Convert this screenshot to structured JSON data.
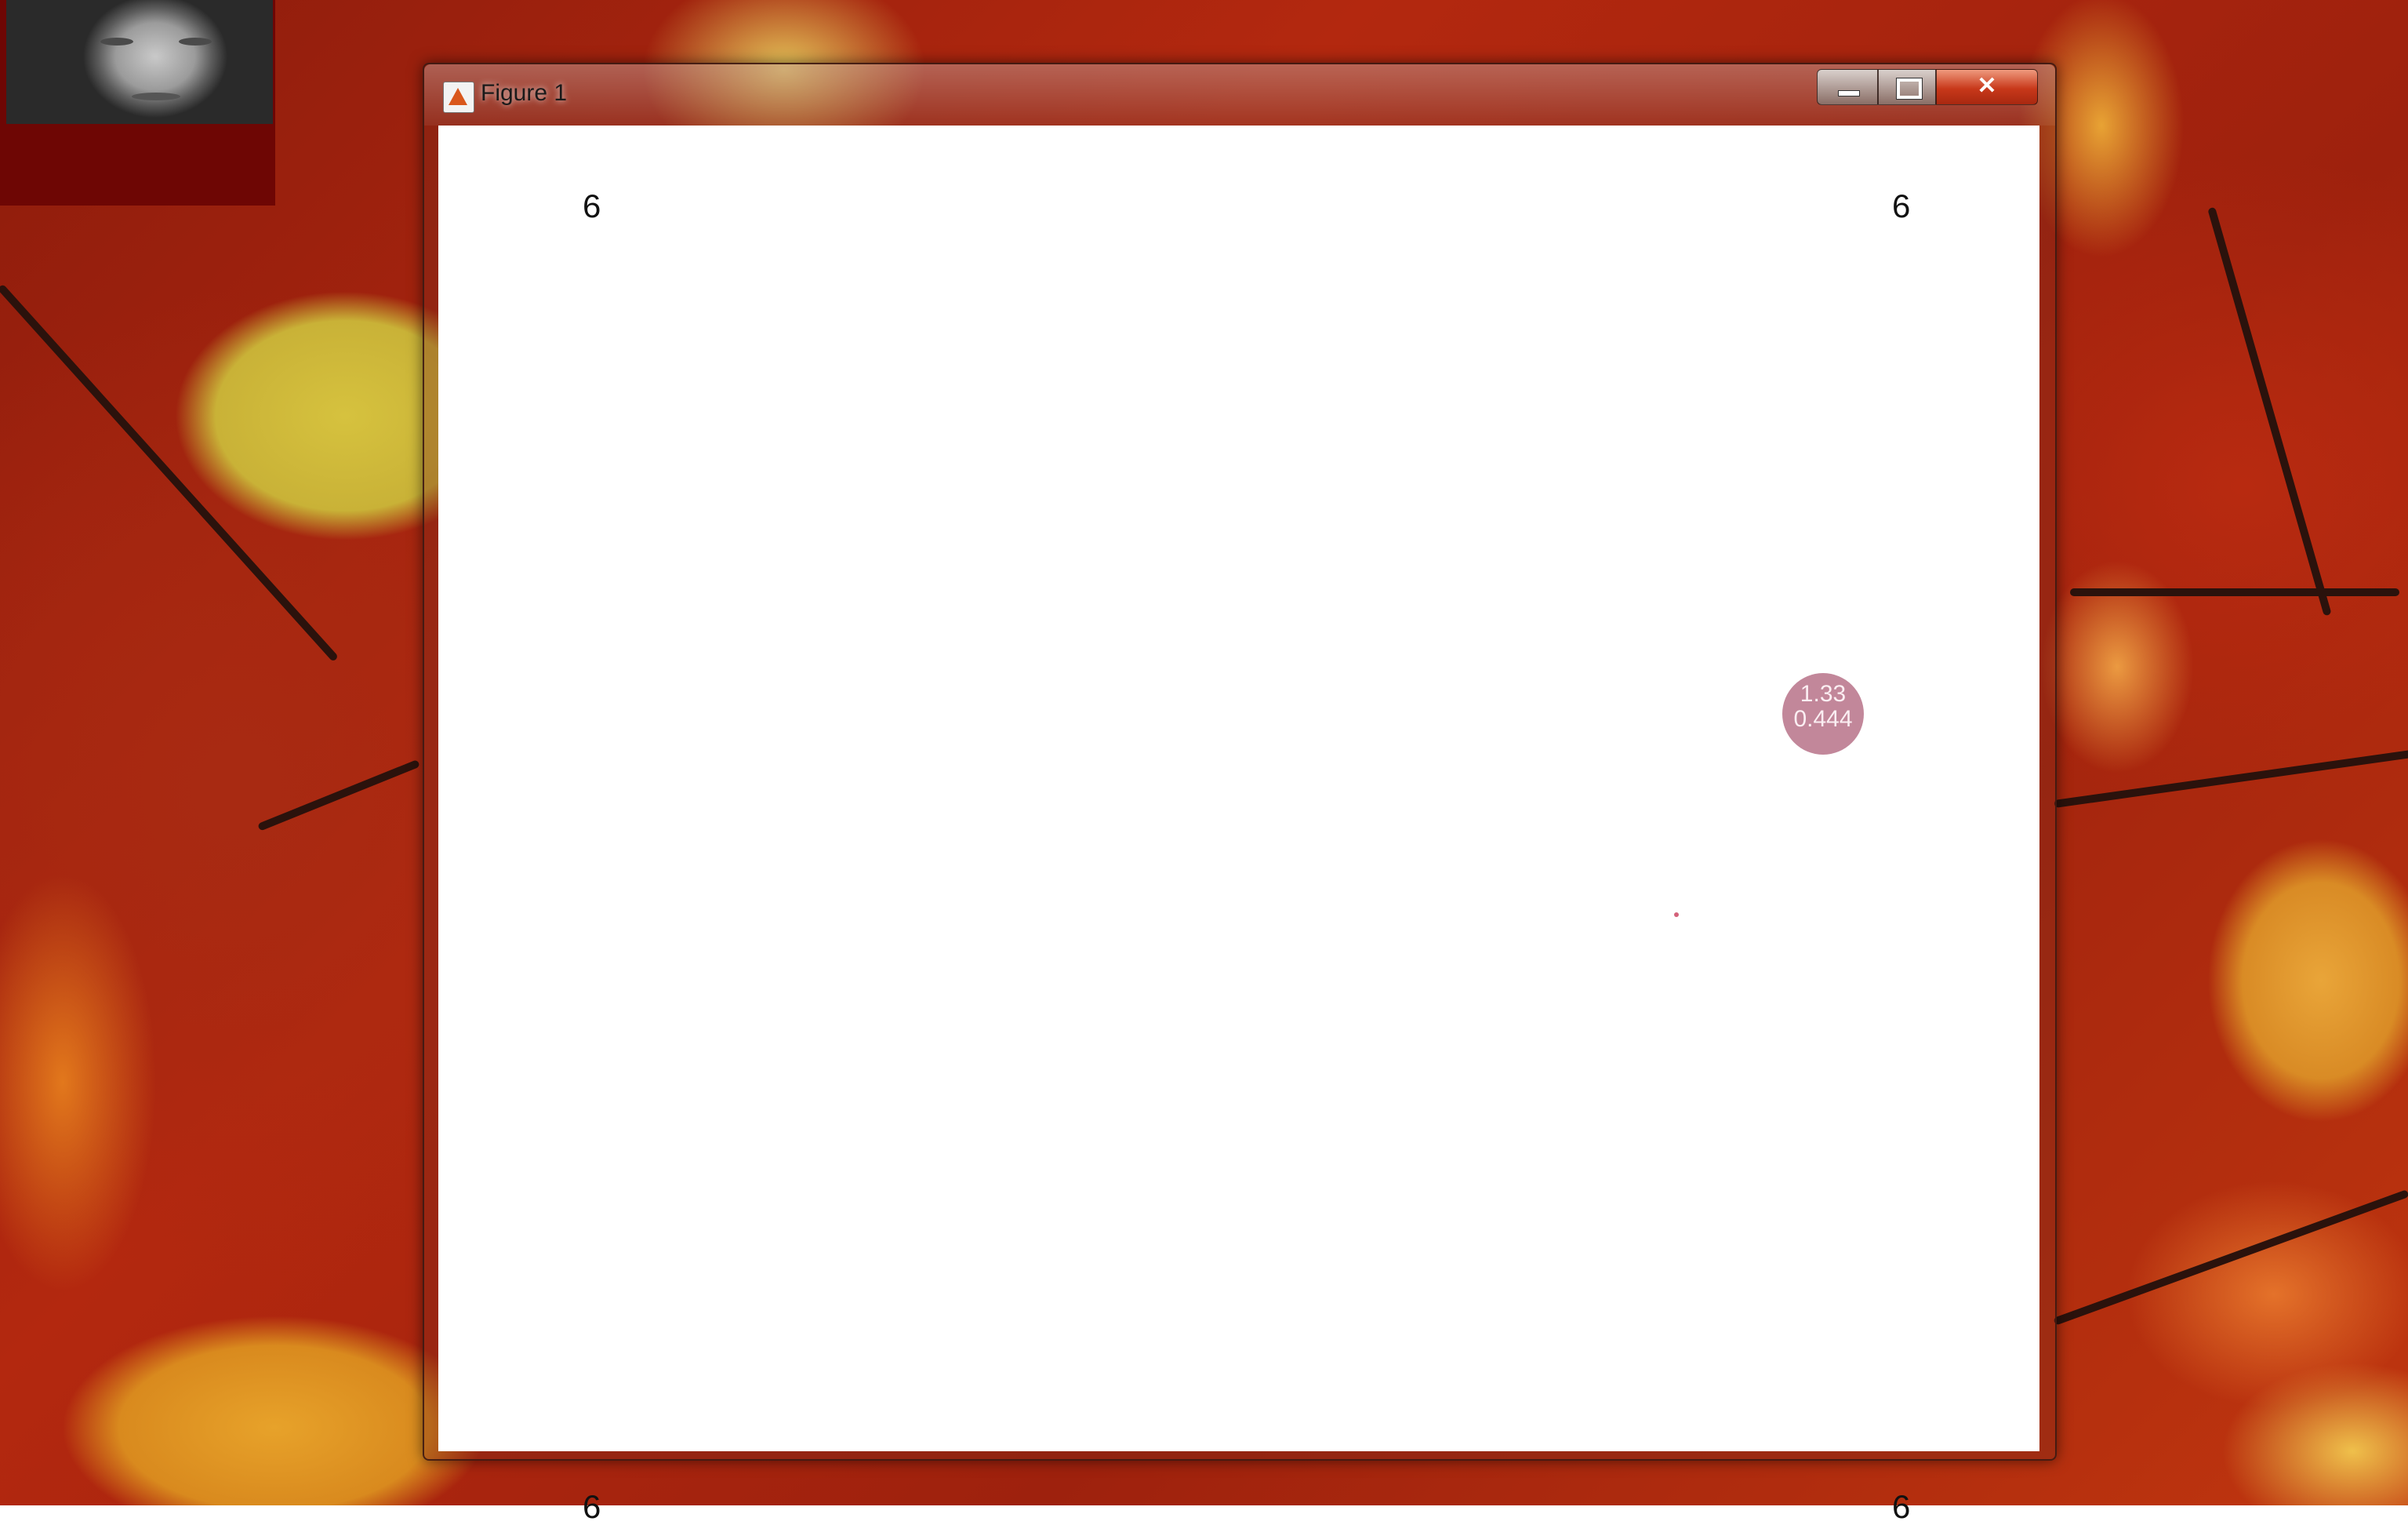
{
  "window": {
    "title": "Figure 1"
  },
  "caption_buttons": {
    "minimize": "minimize-icon",
    "maximize": "maximize-icon",
    "close": "close-icon",
    "close_label": "✕"
  },
  "figure": {
    "corner_labels": {
      "top_left": "6",
      "top_right": "6",
      "bottom_left": "6",
      "bottom_right": "6"
    },
    "target": {
      "line1": "1.33",
      "line2": "0.444",
      "color": "#c2879a"
    },
    "center_dot_color": "#d3627a"
  },
  "webcam": {
    "icon": "webcam-overlay"
  },
  "desktop": {
    "wallpaper": "autumn-leaves"
  }
}
